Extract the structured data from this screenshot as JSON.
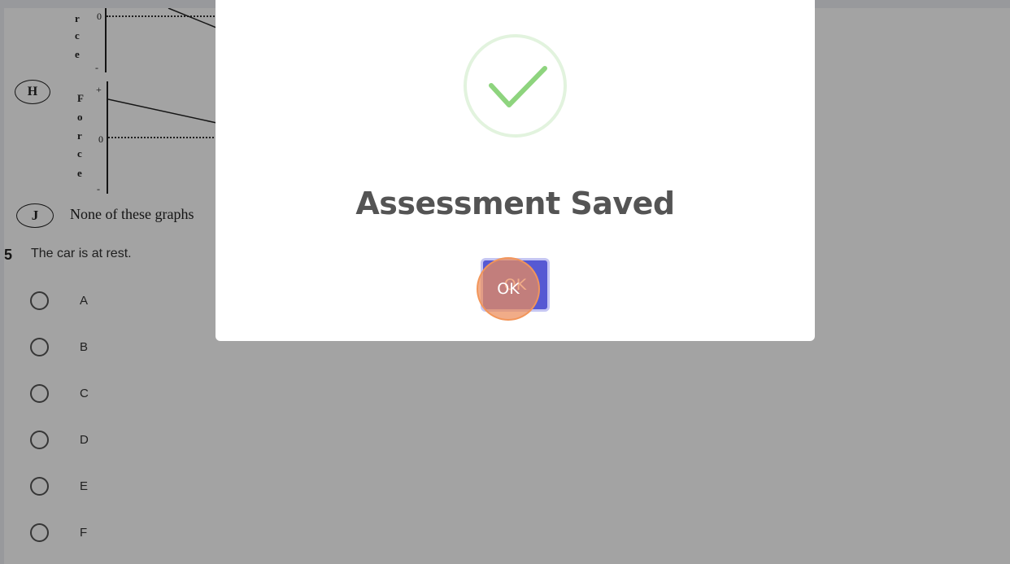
{
  "question": {
    "number": "5",
    "text": "The car is at rest.",
    "choices": [
      {
        "label": "A"
      },
      {
        "label": "B"
      },
      {
        "label": "C"
      },
      {
        "label": "D"
      },
      {
        "label": "E"
      },
      {
        "label": "F"
      }
    ]
  },
  "graphs": {
    "axis_letters_top": [
      "r",
      "c",
      "e"
    ],
    "axis_letters_h": [
      "F",
      "o",
      "r",
      "c",
      "e"
    ],
    "tick_zero": "0",
    "tick_plus": "+",
    "tick_minus": "-",
    "option_h": "H",
    "option_j": "J",
    "option_j_text": "None of these graphs"
  },
  "dialog": {
    "title": "Assessment Saved",
    "ok_label": "OK",
    "icon": "checkmark-success-icon",
    "check_color": "#8ed47e"
  },
  "colors": {
    "ok_button": "#5659d3",
    "click_marker": "#eb8c5a"
  }
}
